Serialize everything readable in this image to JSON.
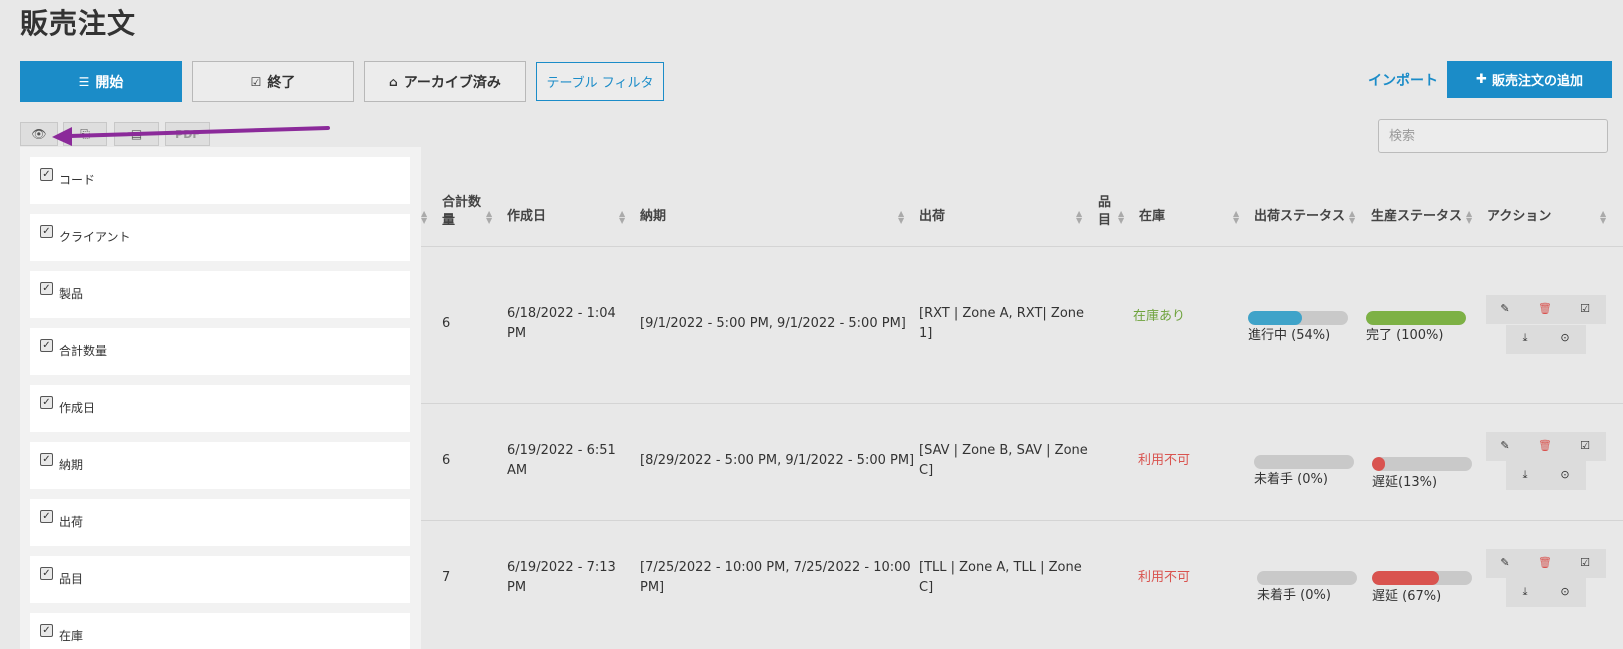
{
  "page": {
    "title": "販売注文"
  },
  "tabs": [
    {
      "label": "開始",
      "icon": "list-icon",
      "active": true
    },
    {
      "label": "終了",
      "icon": "check-square-icon",
      "active": false
    },
    {
      "label": "アーカイブ済み",
      "icon": "inbox-icon",
      "active": false
    }
  ],
  "filter_button": "テーブル フィルタ",
  "import_link": "インポート",
  "add_button": "販売注文の追加",
  "search": {
    "placeholder": "検索",
    "value": ""
  },
  "toolbar": {
    "pdf_label": "PDF"
  },
  "column_visibility": [
    {
      "label": "コード",
      "checked": true
    },
    {
      "label": "クライアント",
      "checked": true
    },
    {
      "label": "製品",
      "checked": true
    },
    {
      "label": "合計数量",
      "checked": true
    },
    {
      "label": "作成日",
      "checked": true
    },
    {
      "label": "納期",
      "checked": true
    },
    {
      "label": "出荷",
      "checked": true
    },
    {
      "label": "品目",
      "checked": true
    },
    {
      "label": "在庫",
      "checked": true
    }
  ],
  "table": {
    "headers": {
      "qty_line1": "合計数",
      "qty_line2": "量",
      "created": "作成日",
      "due": "納期",
      "shipping": "出荷",
      "items_line1": "品",
      "items_line2": "目",
      "stock": "在庫",
      "ship_status": "出荷ステータス",
      "prod_status": "生産ステータス",
      "actions": "アクション"
    },
    "rows": [
      {
        "qty": "6",
        "created_line1": "6/18/2022 - 1:04",
        "created_line2": "PM",
        "due": "[9/1/2022 - 5:00 PM, 9/1/2022 - 5:00 PM]",
        "due_line2": "",
        "ship_line1": "[RXT | Zone A, RXT| Zone",
        "ship_line2": "1]",
        "stock": "在庫あり",
        "stock_state": "ok",
        "ship_status_label": "進行中 (54%)",
        "ship_progress": 0.54,
        "prod_status_label": "完了 (100%)",
        "prod_progress": 1.0
      },
      {
        "qty": "6",
        "created_line1": "6/19/2022 - 6:51",
        "created_line2": "AM",
        "due": "[8/29/2022 - 5:00 PM, 9/1/2022 - 5:00 PM]",
        "due_line2": "",
        "ship_line1": "[SAV | Zone B, SAV | Zone",
        "ship_line2": "C]",
        "stock": "利用不可",
        "stock_state": "unavailable",
        "ship_status_label": "未着手 (0%)",
        "ship_progress": 0,
        "prod_status_label": "遅延(13%)",
        "prod_progress": 0.13
      },
      {
        "qty": "7",
        "created_line1": "6/19/2022 - 7:13",
        "created_line2": "PM",
        "due": "[7/25/2022 - 10:00 PM, 7/25/2022 - 10:00",
        "due_line2": "PM]",
        "ship_line1": "[TLL | Zone A, TLL | Zone",
        "ship_line2": "C]",
        "stock": "利用不可",
        "stock_state": "unavailable",
        "ship_status_label": "未着手 (0%)",
        "ship_progress": 0,
        "prod_status_label": "遅延 (67%)",
        "prod_progress": 0.67
      }
    ]
  },
  "colors": {
    "primary": "#1b8cc8",
    "ok": "#6ea23c",
    "danger": "#d9534f",
    "arrow": "#8b2a9a"
  }
}
